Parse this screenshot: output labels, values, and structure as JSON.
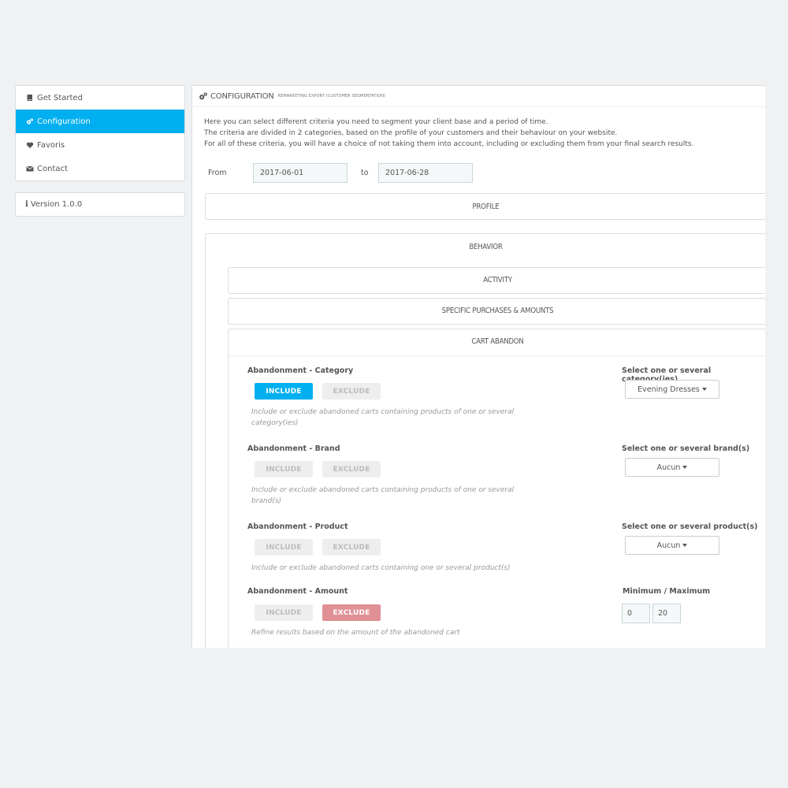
{
  "sidebar": {
    "items": [
      {
        "label": "Get Started",
        "icon": "book-icon",
        "active": false
      },
      {
        "label": "Configuration",
        "icon": "cogs-icon",
        "active": true
      },
      {
        "label": "Favoris",
        "icon": "heart-icon",
        "active": false
      },
      {
        "label": "Contact",
        "icon": "envelope-icon",
        "active": false
      }
    ],
    "version": "Version 1.0.0"
  },
  "header": {
    "title": "CONFIGURATION",
    "subtitle": "REMARKETING EXPORT (CUSTOMER SEGMENTATION)"
  },
  "intro": {
    "line1": "Here you can select different criteria you need to segment your client base and a period of time.",
    "line2": "The criteria are divided in 2 categories, based on the profile of your customers and their behaviour on your website.",
    "line3": "For all of these criteria, you will have a choice of not taking them into account, including or excluding them from your final search results."
  },
  "dates": {
    "from_label": "From",
    "from_value": "2017-06-01",
    "to_label": "to",
    "to_value": "2017-06-28"
  },
  "sections": {
    "profile": "PROFILE",
    "behavior": "BEHAVIOR",
    "activity": "ACTIVITY",
    "specific": "SPECIFIC PURCHASES & AMOUNTS",
    "cart": "CART ABANDON"
  },
  "criteria": {
    "category": {
      "label": "Abandonment - Category",
      "include": "INCLUDE",
      "exclude": "EXCLUDE",
      "state": "include",
      "help1": "Include or exclude abandoned carts containing products of one or several",
      "help2": "category(ies)",
      "select_label": "Select one or several category(ies)",
      "select_value": "Evening Dresses"
    },
    "brand": {
      "label": "Abandonment - Brand",
      "include": "INCLUDE",
      "exclude": "EXCLUDE",
      "state": "none",
      "help1": "Include or exclude abandoned carts containing products of one or several",
      "help2": "brand(s)",
      "select_label": "Select one or several brand(s)",
      "select_value": "Aucun"
    },
    "product": {
      "label": "Abandonment - Product",
      "include": "INCLUDE",
      "exclude": "EXCLUDE",
      "state": "none",
      "help1": "Include or exclude abandoned carts containing one or several product(s)",
      "select_label": "Select one or several product(s)",
      "select_value": "Aucun"
    },
    "amount": {
      "label": "Abandonment - Amount",
      "include": "INCLUDE",
      "exclude": "EXCLUDE",
      "state": "exclude",
      "help1": "Refine results based on the amount of the abandoned cart",
      "minmax_label": "Minimum / Maximum",
      "min": "0",
      "max": "20"
    }
  },
  "colors": {
    "accent": "#00aff0",
    "exclude_active": "#e08f95",
    "background": "#eff1f2"
  }
}
